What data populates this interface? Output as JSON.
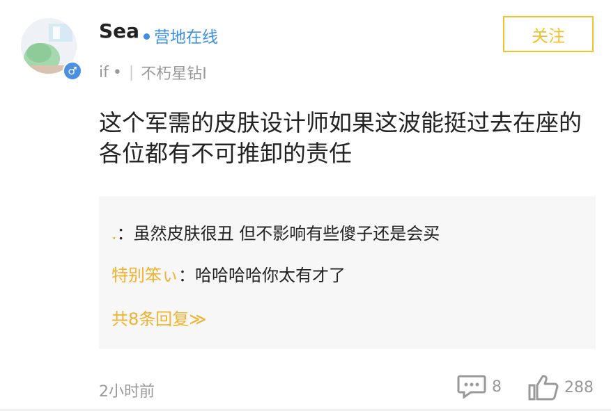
{
  "user": {
    "name": "Sea",
    "status": "营地在线",
    "gender_symbol": "♂",
    "meta_left": "if",
    "meta_dot": "•",
    "meta_sep": "|",
    "rank": "不朽星钻I"
  },
  "follow_label": "关注",
  "post": {
    "content": "这个军需的皮肤设计师如果这波能挺过去在座的各位都有不可推卸的责任",
    "time": "2小时前",
    "comment_count": "8",
    "like_count": "288"
  },
  "replies": [
    {
      "name": ".",
      "colon": "：",
      "text": "虽然皮肤很丑 但不影响有些傻子还是会买"
    },
    {
      "name": "特别笨ぃ",
      "colon": "：",
      "text": "哈哈哈哈你太有才了"
    }
  ],
  "more_replies": "共8条回复≫",
  "colors": {
    "accent": "#f2c12e",
    "online": "#3d8fe6",
    "gender_badge": "#4a90e2"
  }
}
